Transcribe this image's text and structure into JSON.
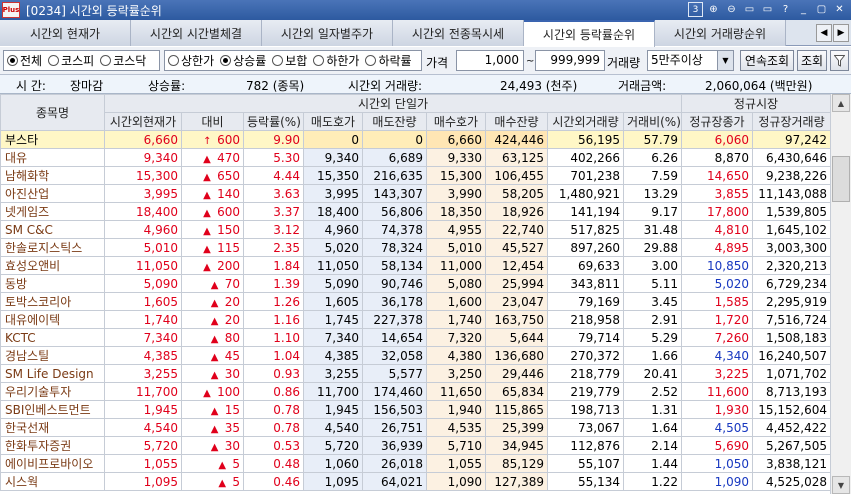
{
  "window": {
    "title": "[0234] 시간외 등락률순위",
    "logo": "Plus",
    "controls": [
      "3",
      "⊕",
      "⊖",
      "▭",
      "▭",
      "?",
      "_",
      "▢",
      "✕"
    ]
  },
  "tabs": [
    {
      "label": "시간외 현재가",
      "active": false
    },
    {
      "label": "시간외 시간별체결",
      "active": false
    },
    {
      "label": "시간외 일자별주가",
      "active": false
    },
    {
      "label": "시간외 전종목시세",
      "active": false
    },
    {
      "label": "시간외 등락률순위",
      "active": true
    },
    {
      "label": "시간외 거래량순위",
      "active": false
    }
  ],
  "tab_nav": [
    "◀",
    "▶"
  ],
  "filters": {
    "market": [
      {
        "label": "전체",
        "checked": true
      },
      {
        "label": "코스피",
        "checked": false
      },
      {
        "label": "코스닥",
        "checked": false
      }
    ],
    "direction": [
      {
        "label": "상한가",
        "checked": false
      },
      {
        "label": "상승률",
        "checked": true
      },
      {
        "label": "보합",
        "checked": false
      },
      {
        "label": "하한가",
        "checked": false
      },
      {
        "label": "하락률",
        "checked": false
      }
    ],
    "price_label": "가격",
    "price_from": "1,000",
    "price_sep": "~",
    "price_to": "999,999",
    "volume_label": "거래량",
    "volume_value": "5만주이상",
    "continuous_button": "연속조회",
    "query_button": "조회",
    "filter_icon": "funnel-icon"
  },
  "summary": {
    "time_label": "시  간:",
    "time_value": "장마감",
    "rise_label": "상승률:",
    "rise_value": "782 (종목)",
    "vol_label": "시간외 거래량:",
    "vol_value": "24,493 (천주)",
    "amount_label": "거래금액:",
    "amount_value": "2,060,064 (백만원)"
  },
  "table": {
    "header_top": {
      "name": "종목명",
      "after_hours": "시간외 단일가",
      "regular": "정규시장"
    },
    "columns": [
      "시간외현재가",
      "대비",
      "등락률(%)",
      "매도호가",
      "매도잔량",
      "매수호가",
      "매수잔량",
      "시간외거래량",
      "거래비(%)",
      "정규장종가",
      "정규장거래량"
    ],
    "rows": [
      {
        "name": "부스타",
        "price": "6,660",
        "arrow": "↑",
        "change": "600",
        "rate": "9.90",
        "ask": "0",
        "ask_qty": "0",
        "bid": "6,660",
        "bid_qty": "424,446",
        "volume": "56,195",
        "vol_ratio": "57.79",
        "close": "6,060",
        "close_dir": "up",
        "reg_vol": "97,242",
        "selected": true
      },
      {
        "name": "대유",
        "price": "9,340",
        "arrow": "▲",
        "change": "470",
        "rate": "5.30",
        "ask": "9,340",
        "ask_qty": "6,689",
        "bid": "9,330",
        "bid_qty": "63,125",
        "volume": "402,266",
        "vol_ratio": "6.26",
        "close": "8,870",
        "close_dir": "flat",
        "reg_vol": "6,430,646"
      },
      {
        "name": "남해화학",
        "price": "15,300",
        "arrow": "▲",
        "change": "650",
        "rate": "4.44",
        "ask": "15,350",
        "ask_qty": "216,635",
        "bid": "15,300",
        "bid_qty": "106,455",
        "volume": "701,238",
        "vol_ratio": "7.59",
        "close": "14,650",
        "close_dir": "up",
        "reg_vol": "9,238,226"
      },
      {
        "name": "아진산업",
        "price": "3,995",
        "arrow": "▲",
        "change": "140",
        "rate": "3.63",
        "ask": "3,995",
        "ask_qty": "143,307",
        "bid": "3,990",
        "bid_qty": "58,205",
        "volume": "1,480,921",
        "vol_ratio": "13.29",
        "close": "3,855",
        "close_dir": "up",
        "reg_vol": "11,143,088"
      },
      {
        "name": "넷게임즈",
        "price": "18,400",
        "arrow": "▲",
        "change": "600",
        "rate": "3.37",
        "ask": "18,400",
        "ask_qty": "56,806",
        "bid": "18,350",
        "bid_qty": "18,926",
        "volume": "141,194",
        "vol_ratio": "9.17",
        "close": "17,800",
        "close_dir": "up",
        "reg_vol": "1,539,805"
      },
      {
        "name": "SM C&C",
        "price": "4,960",
        "arrow": "▲",
        "change": "150",
        "rate": "3.12",
        "ask": "4,960",
        "ask_qty": "74,378",
        "bid": "4,955",
        "bid_qty": "22,740",
        "volume": "517,825",
        "vol_ratio": "31.48",
        "close": "4,810",
        "close_dir": "up",
        "reg_vol": "1,645,102"
      },
      {
        "name": "한솔로지스틱스",
        "price": "5,010",
        "arrow": "▲",
        "change": "115",
        "rate": "2.35",
        "ask": "5,020",
        "ask_qty": "78,324",
        "bid": "5,010",
        "bid_qty": "45,527",
        "volume": "897,260",
        "vol_ratio": "29.88",
        "close": "4,895",
        "close_dir": "up",
        "reg_vol": "3,003,300"
      },
      {
        "name": "효성오앤비",
        "price": "11,050",
        "arrow": "▲",
        "change": "200",
        "rate": "1.84",
        "ask": "11,050",
        "ask_qty": "58,134",
        "bid": "11,000",
        "bid_qty": "12,454",
        "volume": "69,633",
        "vol_ratio": "3.00",
        "close": "10,850",
        "close_dir": "dn",
        "reg_vol": "2,320,213"
      },
      {
        "name": "동방",
        "price": "5,090",
        "arrow": "▲",
        "change": "70",
        "rate": "1.39",
        "ask": "5,090",
        "ask_qty": "90,746",
        "bid": "5,080",
        "bid_qty": "25,994",
        "volume": "343,811",
        "vol_ratio": "5.11",
        "close": "5,020",
        "close_dir": "dn",
        "reg_vol": "6,729,234"
      },
      {
        "name": "토박스코리아",
        "price": "1,605",
        "arrow": "▲",
        "change": "20",
        "rate": "1.26",
        "ask": "1,605",
        "ask_qty": "36,178",
        "bid": "1,600",
        "bid_qty": "23,047",
        "volume": "79,169",
        "vol_ratio": "3.45",
        "close": "1,585",
        "close_dir": "up",
        "reg_vol": "2,295,919"
      },
      {
        "name": "대유에이텍",
        "price": "1,740",
        "arrow": "▲",
        "change": "20",
        "rate": "1.16",
        "ask": "1,745",
        "ask_qty": "227,378",
        "bid": "1,740",
        "bid_qty": "163,750",
        "volume": "218,958",
        "vol_ratio": "2.91",
        "close": "1,720",
        "close_dir": "up",
        "reg_vol": "7,516,724"
      },
      {
        "name": "KCTC",
        "price": "7,340",
        "arrow": "▲",
        "change": "80",
        "rate": "1.10",
        "ask": "7,340",
        "ask_qty": "14,654",
        "bid": "7,320",
        "bid_qty": "5,644",
        "volume": "79,714",
        "vol_ratio": "5.29",
        "close": "7,260",
        "close_dir": "up",
        "reg_vol": "1,508,183"
      },
      {
        "name": "경남스틸",
        "price": "4,385",
        "arrow": "▲",
        "change": "45",
        "rate": "1.04",
        "ask": "4,385",
        "ask_qty": "32,058",
        "bid": "4,380",
        "bid_qty": "136,680",
        "volume": "270,372",
        "vol_ratio": "1.66",
        "close": "4,340",
        "close_dir": "dn",
        "reg_vol": "16,240,507"
      },
      {
        "name": "SM Life Design",
        "price": "3,255",
        "arrow": "▲",
        "change": "30",
        "rate": "0.93",
        "ask": "3,255",
        "ask_qty": "5,577",
        "bid": "3,250",
        "bid_qty": "29,446",
        "volume": "218,779",
        "vol_ratio": "20.41",
        "close": "3,225",
        "close_dir": "up",
        "reg_vol": "1,071,702"
      },
      {
        "name": "우리기술투자",
        "price": "11,700",
        "arrow": "▲",
        "change": "100",
        "rate": "0.86",
        "ask": "11,700",
        "ask_qty": "174,460",
        "bid": "11,650",
        "bid_qty": "65,834",
        "volume": "219,779",
        "vol_ratio": "2.52",
        "close": "11,600",
        "close_dir": "up",
        "reg_vol": "8,713,193"
      },
      {
        "name": "SBI인베스트먼트",
        "price": "1,945",
        "arrow": "▲",
        "change": "15",
        "rate": "0.78",
        "ask": "1,945",
        "ask_qty": "156,503",
        "bid": "1,940",
        "bid_qty": "115,865",
        "volume": "198,713",
        "vol_ratio": "1.31",
        "close": "1,930",
        "close_dir": "up",
        "reg_vol": "15,152,604"
      },
      {
        "name": "한국선재",
        "price": "4,540",
        "arrow": "▲",
        "change": "35",
        "rate": "0.78",
        "ask": "4,540",
        "ask_qty": "26,751",
        "bid": "4,535",
        "bid_qty": "25,399",
        "volume": "73,067",
        "vol_ratio": "1.64",
        "close": "4,505",
        "close_dir": "dn",
        "reg_vol": "4,452,422"
      },
      {
        "name": "한화투자증권",
        "price": "5,720",
        "arrow": "▲",
        "change": "30",
        "rate": "0.53",
        "ask": "5,720",
        "ask_qty": "36,939",
        "bid": "5,710",
        "bid_qty": "34,945",
        "volume": "112,876",
        "vol_ratio": "2.14",
        "close": "5,690",
        "close_dir": "up",
        "reg_vol": "5,267,505"
      },
      {
        "name": "에이비프로바이오",
        "price": "1,055",
        "arrow": "▲",
        "change": "5",
        "rate": "0.48",
        "ask": "1,060",
        "ask_qty": "26,018",
        "bid": "1,055",
        "bid_qty": "85,129",
        "volume": "55,107",
        "vol_ratio": "1.44",
        "close": "1,050",
        "close_dir": "dn",
        "reg_vol": "3,838,121"
      },
      {
        "name": "시스웍",
        "price": "1,095",
        "arrow": "▲",
        "change": "5",
        "rate": "0.46",
        "ask": "1,095",
        "ask_qty": "64,021",
        "bid": "1,090",
        "bid_qty": "127,389",
        "volume": "55,134",
        "vol_ratio": "1.22",
        "close": "1,090",
        "close_dir": "dn",
        "reg_vol": "4,525,028"
      }
    ]
  },
  "scrollbar": {
    "up": "▲",
    "down": "▼"
  },
  "colors": {
    "up": "#e0001b",
    "down": "#1838c0",
    "selected_row": "#fff7c6",
    "title_bar": "#2d5aa0"
  }
}
